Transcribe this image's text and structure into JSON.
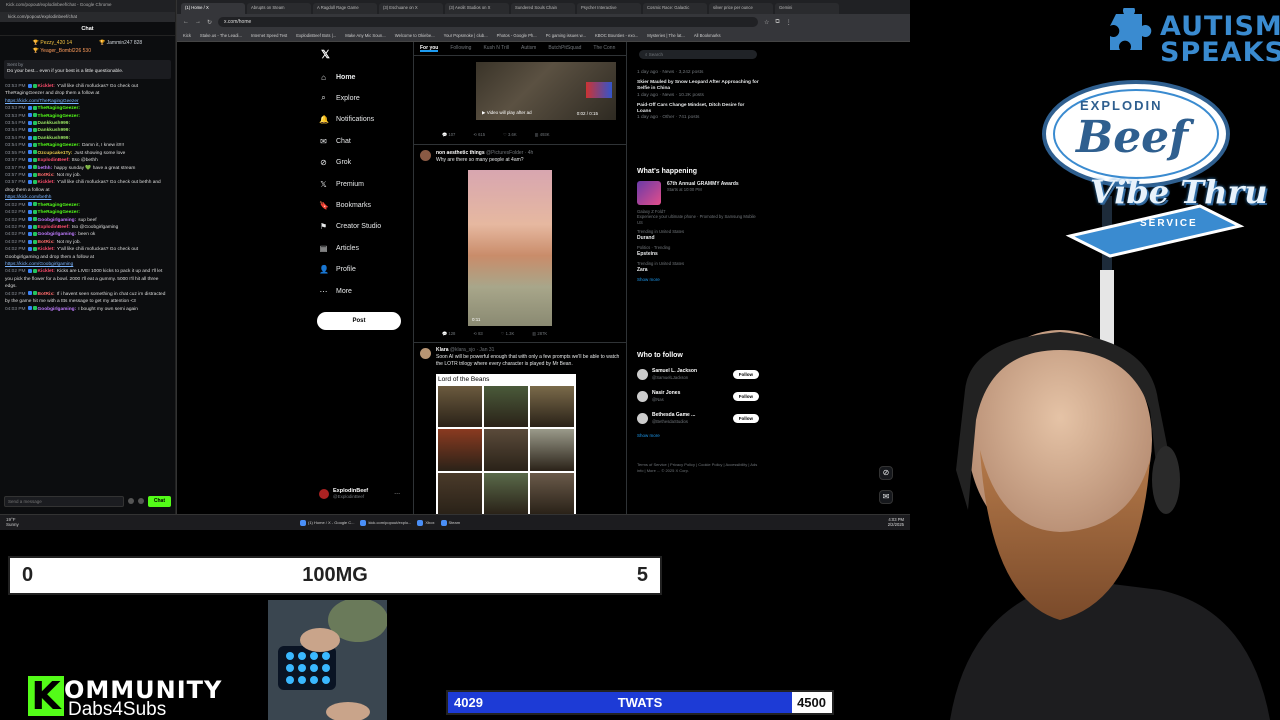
{
  "chat": {
    "url_bar": "Kick.com/popout/explodinbeef/chat - Google Chrome",
    "url": "kick.com/popout/explodinbeef/chat",
    "header": "Chat",
    "gifters": [
      {
        "name": "Pezzy_420",
        "count": "14"
      },
      {
        "name": "Jammin247",
        "count": "828"
      },
      {
        "name": "Yeager_Bombl226",
        "count": "530"
      }
    ],
    "pinned_by": "Sent by",
    "pinned_text": "Do your best... even if your best is a little questionable.",
    "messages": [
      {
        "time": "03:53 PM",
        "user": "Kicklet:",
        "color": "#ff4d6d",
        "text": "Y'all like chili mofuckas? Go check out TheRagingGeezer and drop them a follow at",
        "link": "https://kick.com/TheRagingGeezer"
      },
      {
        "time": "03:53 PM",
        "user": "TheRagingGeezer:",
        "color": "#53fc18",
        "text": ""
      },
      {
        "time": "03:53 PM",
        "user": "TheRagingGeezer:",
        "color": "#53fc18",
        "text": ""
      },
      {
        "time": "03:54 PM",
        "user": "Dankkush999:",
        "color": "#9be564",
        "text": ""
      },
      {
        "time": "03:54 PM",
        "user": "Dankkush999:",
        "color": "#9be564",
        "text": ""
      },
      {
        "time": "03:54 PM",
        "user": "Dankkush999:",
        "color": "#9be564",
        "text": ""
      },
      {
        "time": "03:54 PM",
        "user": "TheRagingGeezer:",
        "color": "#53fc18",
        "text": "Damn it, I knew it!!!!"
      },
      {
        "time": "03:55 PM",
        "user": "Ozcupcake1Ty:",
        "color": "#e6c84b",
        "text": "Just showing some love"
      },
      {
        "time": "03:57 PM",
        "user": "ExplodinBeef:",
        "color": "#ff4d6d",
        "text": "ttso @bethh"
      },
      {
        "time": "03:57 PM",
        "user": "bethh:",
        "color": "#c07bff",
        "text": "happy sunday 💚 have a great stream"
      },
      {
        "time": "03:57 PM",
        "user": "BotRix:",
        "color": "#ff6b6b",
        "text": "Not my job."
      },
      {
        "time": "03:57 PM",
        "user": "Kicklet:",
        "color": "#ff4d6d",
        "text": "Y'all like chili mofuckas? Go check out bethh and drop them a follow at",
        "link": "https://kick.com/bethh"
      },
      {
        "time": "04:02 PM",
        "user": "TheRagingGeezer:",
        "color": "#53fc18",
        "text": ""
      },
      {
        "time": "04:02 PM",
        "user": "TheRagingGeezer:",
        "color": "#53fc18",
        "text": ""
      },
      {
        "time": "04:02 PM",
        "user": "Goobgirlgaming:",
        "color": "#c07bff",
        "text": "sup beef"
      },
      {
        "time": "04:02 PM",
        "user": "ExplodinBeef:",
        "color": "#ff4d6d",
        "text": "tso @Goobgirlgaming"
      },
      {
        "time": "04:02 PM",
        "user": "Goobgirlgaming:",
        "color": "#c07bff",
        "text": "been ok"
      },
      {
        "time": "04:02 PM",
        "user": "BotRix:",
        "color": "#ff6b6b",
        "text": "Not my job."
      },
      {
        "time": "04:02 PM",
        "user": "Kicklet:",
        "color": "#ff4d6d",
        "text": "Y'all like chili mofuckas? Go check out Goobgirlgaming and drop them a follow at",
        "link": "https://kick.com/Goobgirlgaming"
      },
      {
        "time": "04:02 PM",
        "user": "Kicklet:",
        "color": "#ff4d6d",
        "text": "Kicks are LIVE! 1000 kicks to pack it up and I'll let you pick the flower for a bowl. 2000 I'll eat a gummy. 5000 I'll hit all three edgs."
      },
      {
        "time": "04:02 PM",
        "user": "BotRix:",
        "color": "#ff6b6b",
        "text": "If i havent seen something in chat cuz im distracted by the game hit me with a ttts message to get my attention <3"
      },
      {
        "time": "04:03 PM",
        "user": "Goobgirlgaming:",
        "color": "#c07bff",
        "text": "I bought my own semi again"
      }
    ],
    "input_placeholder": "Send a message",
    "send_label": "Chat"
  },
  "browser": {
    "tabs": [
      "(1) Home / X",
      "Abrupts on Steam",
      "A Ragdoll Rage Game",
      "(3) Eschuane on X",
      "(3) Aeolit Studios on X",
      "Sundered Souls Chain",
      "Psycher Interactive",
      "Cosmic Race: Galactic",
      "silver price per ounce",
      "Gemini"
    ],
    "url": "x.com/home",
    "bookmarks": [
      "Kick",
      "Stake.us - The Leadi...",
      "Internet Speed Test",
      "ExplodinBeef Bots |...",
      "Make Any Mic Soun...",
      "Welcome to Okiebe...",
      "Your Popsmoke | club...",
      "Photos - Google Ph...",
      "Pc gaming issues w...",
      "KBOC Bounties - exo...",
      "Mysteries | The lat...",
      "All Bookmarks"
    ]
  },
  "x": {
    "nav": [
      "Home",
      "Explore",
      "Notifications",
      "Chat",
      "Grok",
      "Premium",
      "Bookmarks",
      "Creator Studio",
      "Articles",
      "Profile",
      "More"
    ],
    "post_label": "Post",
    "account_name": "ExplodinBeef",
    "account_handle": "@ExplodinBeef",
    "timeline_tabs": [
      "For you",
      "Following",
      "Kush N Trill",
      "Autism",
      "ButchPitSquad",
      "The Conn"
    ],
    "post1": {
      "video_caption": "Video will play after ad",
      "time": "0:02 / 0:15",
      "stats": [
        "107",
        "615",
        "3.6K",
        "493K"
      ]
    },
    "post2": {
      "name": "non aesthetic things",
      "handle": "@PicturesFolder · 4h",
      "text": "Why are there so many people at 4am?",
      "video_time": "0:11",
      "stats": [
        "128",
        "83",
        "1.3K",
        "287K"
      ]
    },
    "post3": {
      "name": "Klara",
      "handle": "@klara_sjo · Jan 31",
      "text": "Soon AI will be powerful enough that with only a few prompts we'll be able to watch the LOTR trilogy where every character is played by Mr Bean.",
      "image_title": "Lord of the Beans"
    },
    "search_placeholder": "Search",
    "top_news": [
      {
        "title": "",
        "meta": "1 day ago · News · 3,242 posts"
      },
      {
        "title": "Skier Mauled by Snow Leopard After Approaching for Selfie in China",
        "meta": "1 day ago · News · 10.2K posts"
      },
      {
        "title": "Paid-Off Cars Change Mindset, Ditch Desire for Loans",
        "meta": "1 day ago · Other · 741 posts"
      }
    ],
    "whats_happening_title": "What's happening",
    "event": {
      "title": "67th Annual GRAMMY Awards",
      "meta": "Starts at 10:00 PM"
    },
    "trends": [
      {
        "cat": "Galaxy Z Fold7",
        "name": "",
        "sub": "Experience your ultimate phone · Promoted by Samsung Mobile US"
      },
      {
        "cat": "Trending in United States",
        "name": "Durand",
        "sub": ""
      },
      {
        "cat": "Politics · Trending",
        "name": "Epsteins",
        "sub": ""
      },
      {
        "cat": "Trending in United States",
        "name": "Zara",
        "sub": ""
      }
    ],
    "show_more": "Show more",
    "who_to_follow_title": "Who to follow",
    "who_to_follow": [
      {
        "name": "Samuel L. Jackson",
        "handle": "@SamuelLJackson"
      },
      {
        "name": "Nasir Jones",
        "handle": "@Nas"
      },
      {
        "name": "Bethesda Game ...",
        "handle": "@BethesdaStudios"
      }
    ],
    "follow_label": "Follow",
    "footer": "Terms of Service | Privacy Policy | Cookie Policy | Accessibility | Ads info | More ... © 2025 X Corp."
  },
  "taskbar": {
    "weather_temp": "19°F",
    "weather_desc": "Sunny",
    "apps": [
      "(1) Home / X - Google C...",
      "kick.com/popout/explo...",
      "Xbox",
      "Steam"
    ],
    "time": "4:03 PM",
    "date": "2/2/2025"
  },
  "overlay": {
    "autism_line1": "AUTISM",
    "autism_line2": "SPEAKS",
    "beef_top": "EXPLODIN",
    "beef_main": "Beef",
    "vibe_main": "Vibe Thru",
    "vibe_sub": "SERVICE",
    "goal1": {
      "start": "0",
      "label": "100MG",
      "end": "5",
      "progress": 0
    },
    "kommunity_k": "K",
    "kommunity_rest": "OMMUNITY",
    "kommunity_sub": "Dabs4Subs",
    "goal2": {
      "start": "4029",
      "label": "TWATS",
      "end": "4500",
      "progress": 0.895
    }
  },
  "colors": {
    "kick_green": "#53fc18",
    "x_blue": "#1d9bf0",
    "goal_blue": "#1d3bd6",
    "autism_blue": "#3a8bd0"
  }
}
